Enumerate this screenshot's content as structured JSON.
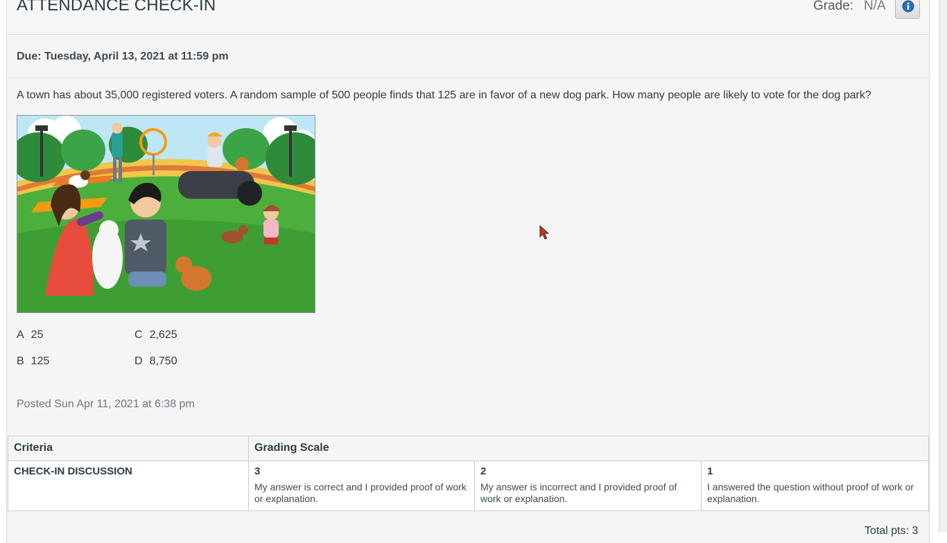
{
  "header": {
    "title": "ATTENDANCE CHECK-IN",
    "grade_label": "Grade:",
    "grade_value": "N/A",
    "info_icon": "info-icon"
  },
  "due": "Due: Tuesday, April 13, 2021 at 11:59 pm",
  "question": "A town has about 35,000 registered voters. A random sample of 500 people finds that 125 are in favor of a new dog park. How many people are likely to vote for the dog park?",
  "illustration": "dog-park-illustration",
  "choices": [
    {
      "letter": "A",
      "value": "25"
    },
    {
      "letter": "C",
      "value": "2,625"
    },
    {
      "letter": "B",
      "value": "125"
    },
    {
      "letter": "D",
      "value": "8,750"
    }
  ],
  "posted": "Posted Sun Apr 11, 2021 at 6:38 pm",
  "rubric": {
    "headers": [
      "Criteria",
      "Grading Scale"
    ],
    "criterion": "CHECK-IN DISCUSSION",
    "ratings": [
      {
        "points": "3",
        "description": "My answer is correct and I provided proof of work or explanation."
      },
      {
        "points": "2",
        "description": "My answer is incorrect and I provided proof of work or explanation."
      },
      {
        "points": "1",
        "description": "I answered the question without proof of work or explanation."
      }
    ],
    "total": "Total pts: 3"
  },
  "colors": {
    "text": "#2d3b45",
    "panel_bg": "#f5f5f5",
    "border": "#c7cdd1",
    "info_blue": "#2a6ebb",
    "cursor_red": "#c0392b"
  }
}
